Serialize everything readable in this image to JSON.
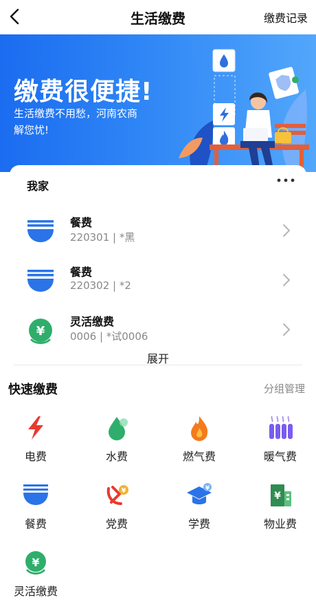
{
  "header": {
    "title": "生活缴费",
    "records_label": "缴费记录",
    "back_icon": "chevron-left-icon"
  },
  "banner": {
    "headline": "缴费很便捷!",
    "subtitle_line1": "生活缴费不用愁，河南农商",
    "subtitle_line2": "解您忧!",
    "illustration_icons": [
      "water-drop-icon",
      "lightning-icon",
      "flame-icon",
      "shield-icon"
    ]
  },
  "home": {
    "title": "我家",
    "more_icon": "more-horizontal-icon",
    "items": [
      {
        "icon": "bowl-icon",
        "name": "餐费",
        "detail": "220301 | *黑"
      },
      {
        "icon": "bowl-icon",
        "name": "餐费",
        "detail": "220302 | *2"
      },
      {
        "icon": "flexible-pay-icon",
        "name": "灵活缴费",
        "detail": "0006 | *试0006"
      }
    ],
    "expand_label": "展开"
  },
  "quick_pay": {
    "title": "快速缴费",
    "manage_label": "分组管理",
    "items": [
      {
        "icon": "electricity-icon",
        "label": "电费"
      },
      {
        "icon": "water-icon",
        "label": "水费"
      },
      {
        "icon": "gas-icon",
        "label": "燃气费"
      },
      {
        "icon": "heating-icon",
        "label": "暖气费"
      },
      {
        "icon": "bowl-icon",
        "label": "餐费"
      },
      {
        "icon": "party-fee-icon",
        "label": "党费"
      },
      {
        "icon": "tuition-icon",
        "label": "学费"
      },
      {
        "icon": "property-fee-icon",
        "label": "物业费"
      },
      {
        "icon": "flexible-pay-icon",
        "label": "灵活缴费"
      }
    ]
  },
  "colors": {
    "banner_start": "#1b6cf0",
    "banner_end": "#52a7fb",
    "bowl_blue": "#2a74e8",
    "green": "#2fae6b",
    "red": "#e83a2f",
    "orange": "#f47a1e",
    "purple": "#7a5cf0",
    "text_gray": "#888888"
  }
}
